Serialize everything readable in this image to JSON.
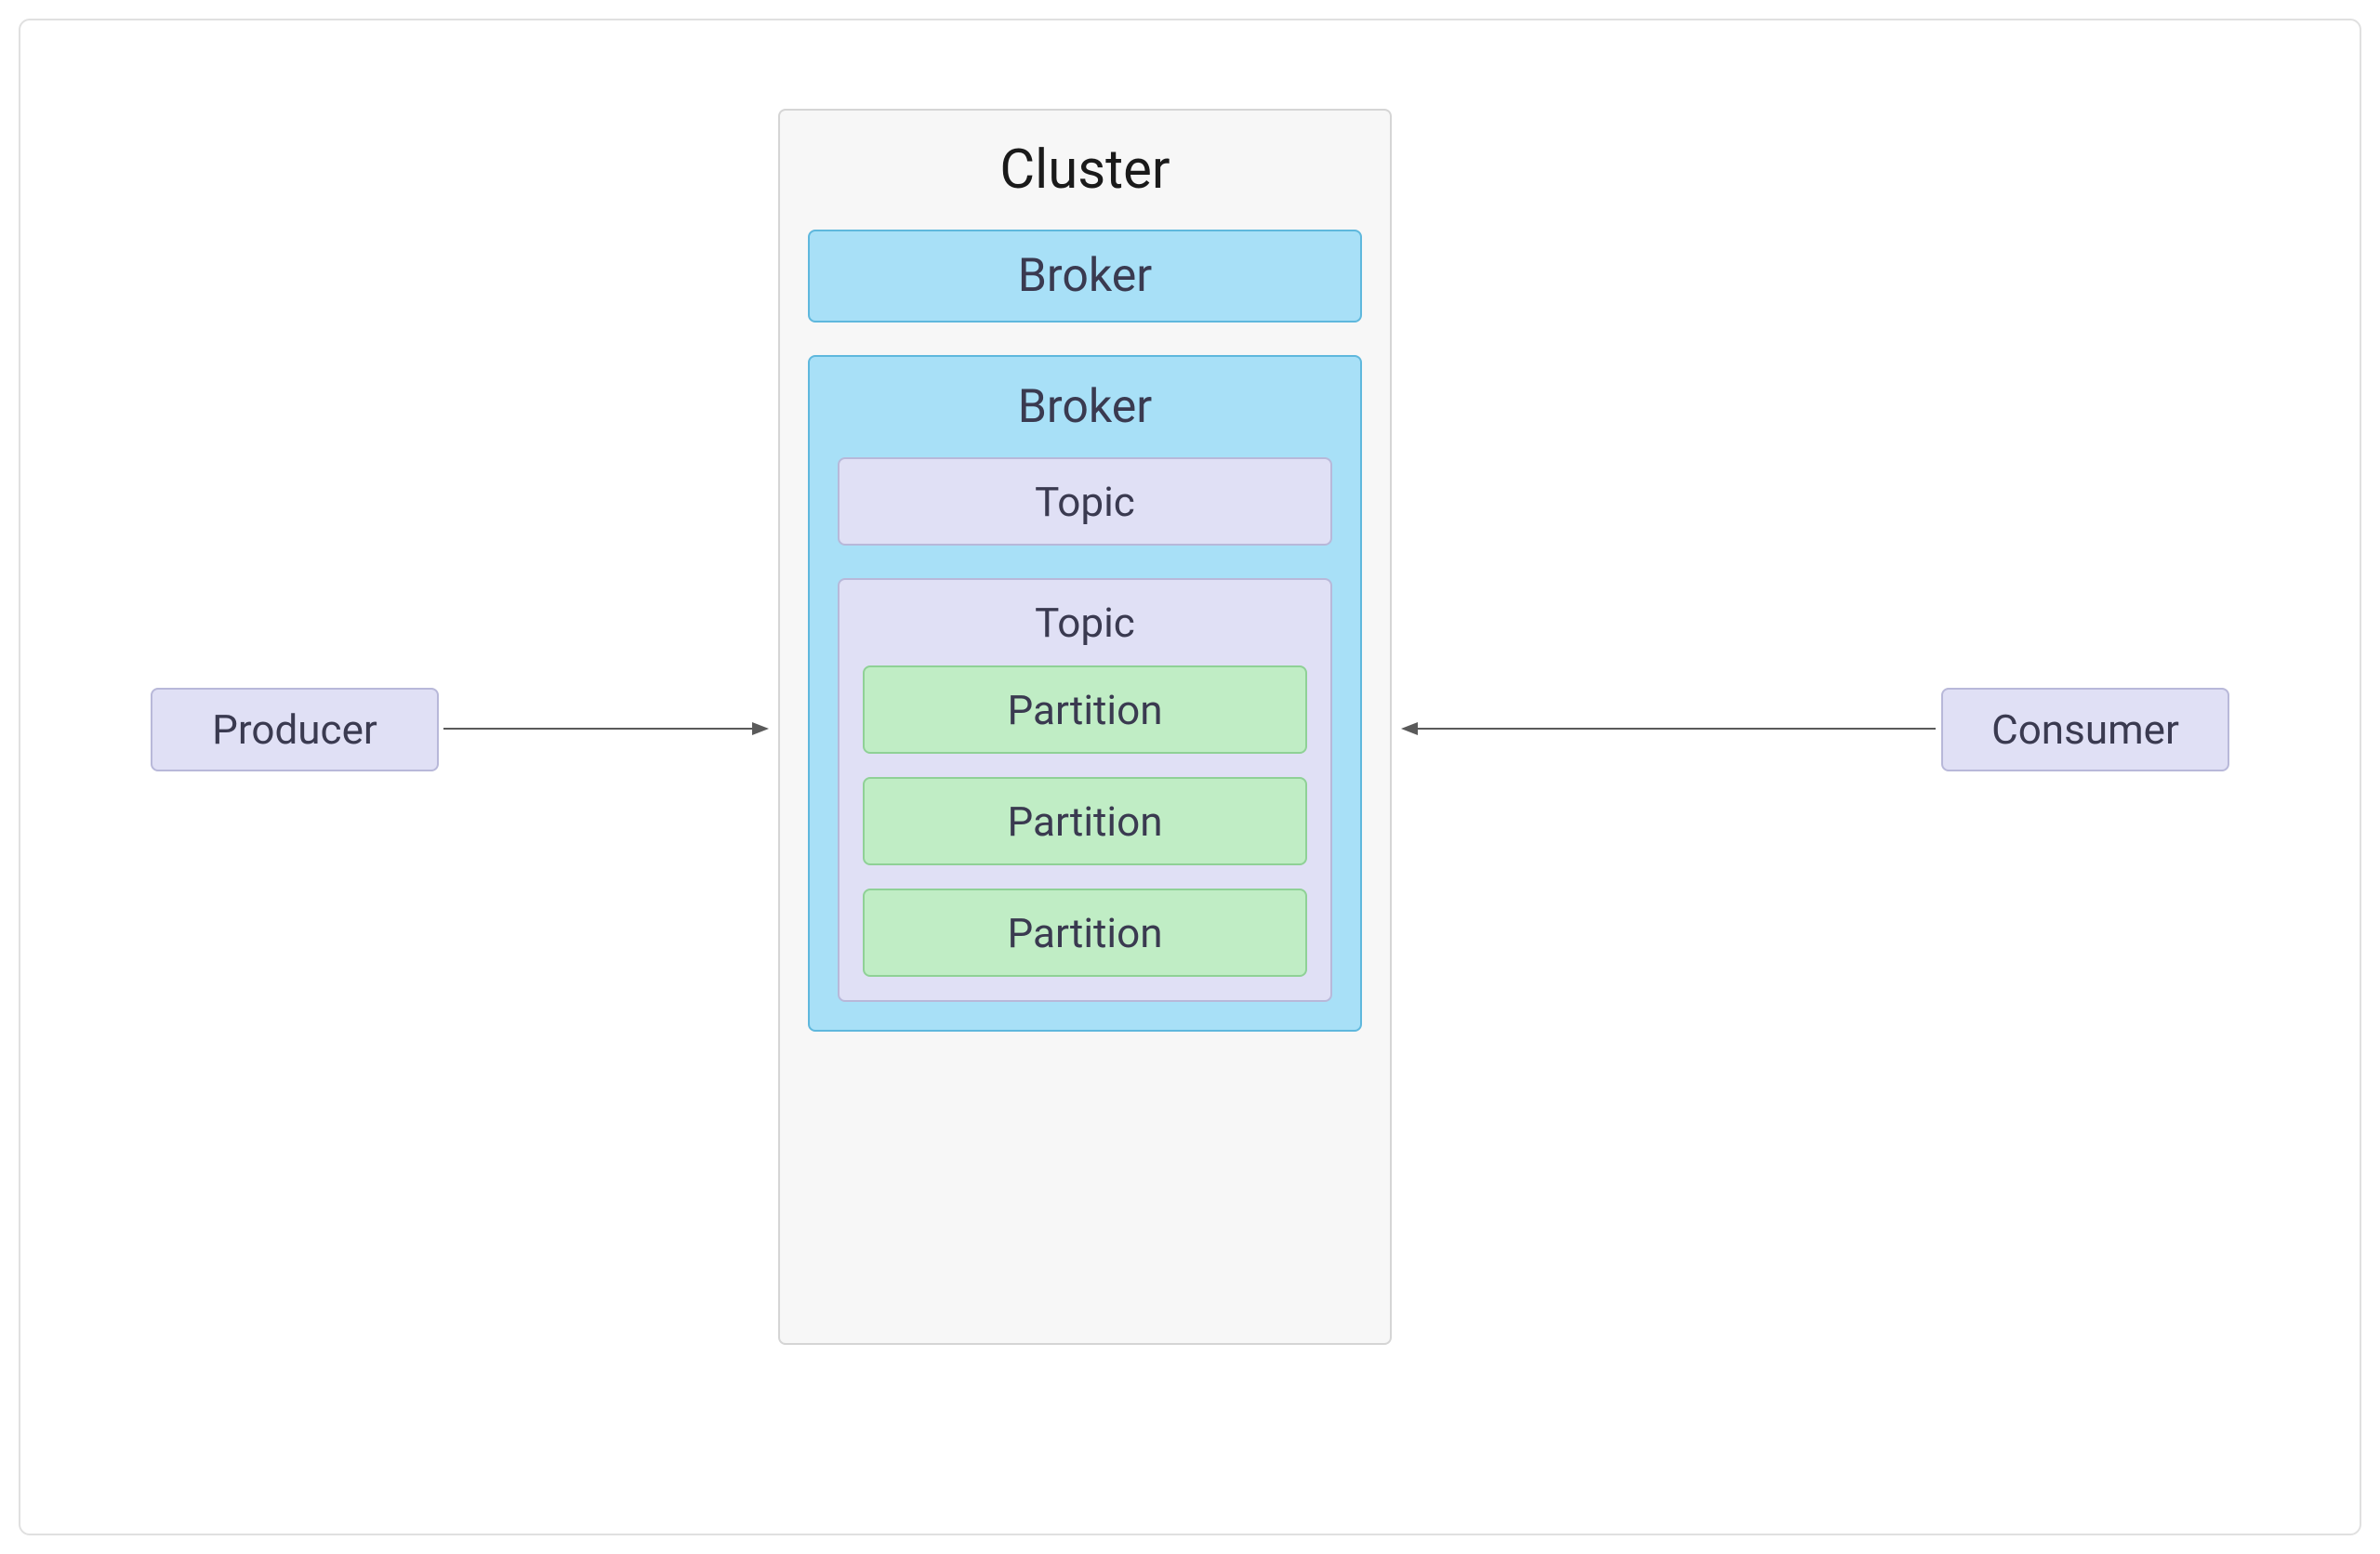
{
  "producer": {
    "label": "Producer"
  },
  "consumer": {
    "label": "Consumer"
  },
  "cluster": {
    "title": "Cluster",
    "broker_simple": {
      "label": "Broker"
    },
    "broker_expanded": {
      "label": "Broker",
      "topic_simple": {
        "label": "Topic"
      },
      "topic_expanded": {
        "label": "Topic",
        "partitions": [
          {
            "label": "Partition"
          },
          {
            "label": "Partition"
          },
          {
            "label": "Partition"
          }
        ]
      }
    }
  }
}
